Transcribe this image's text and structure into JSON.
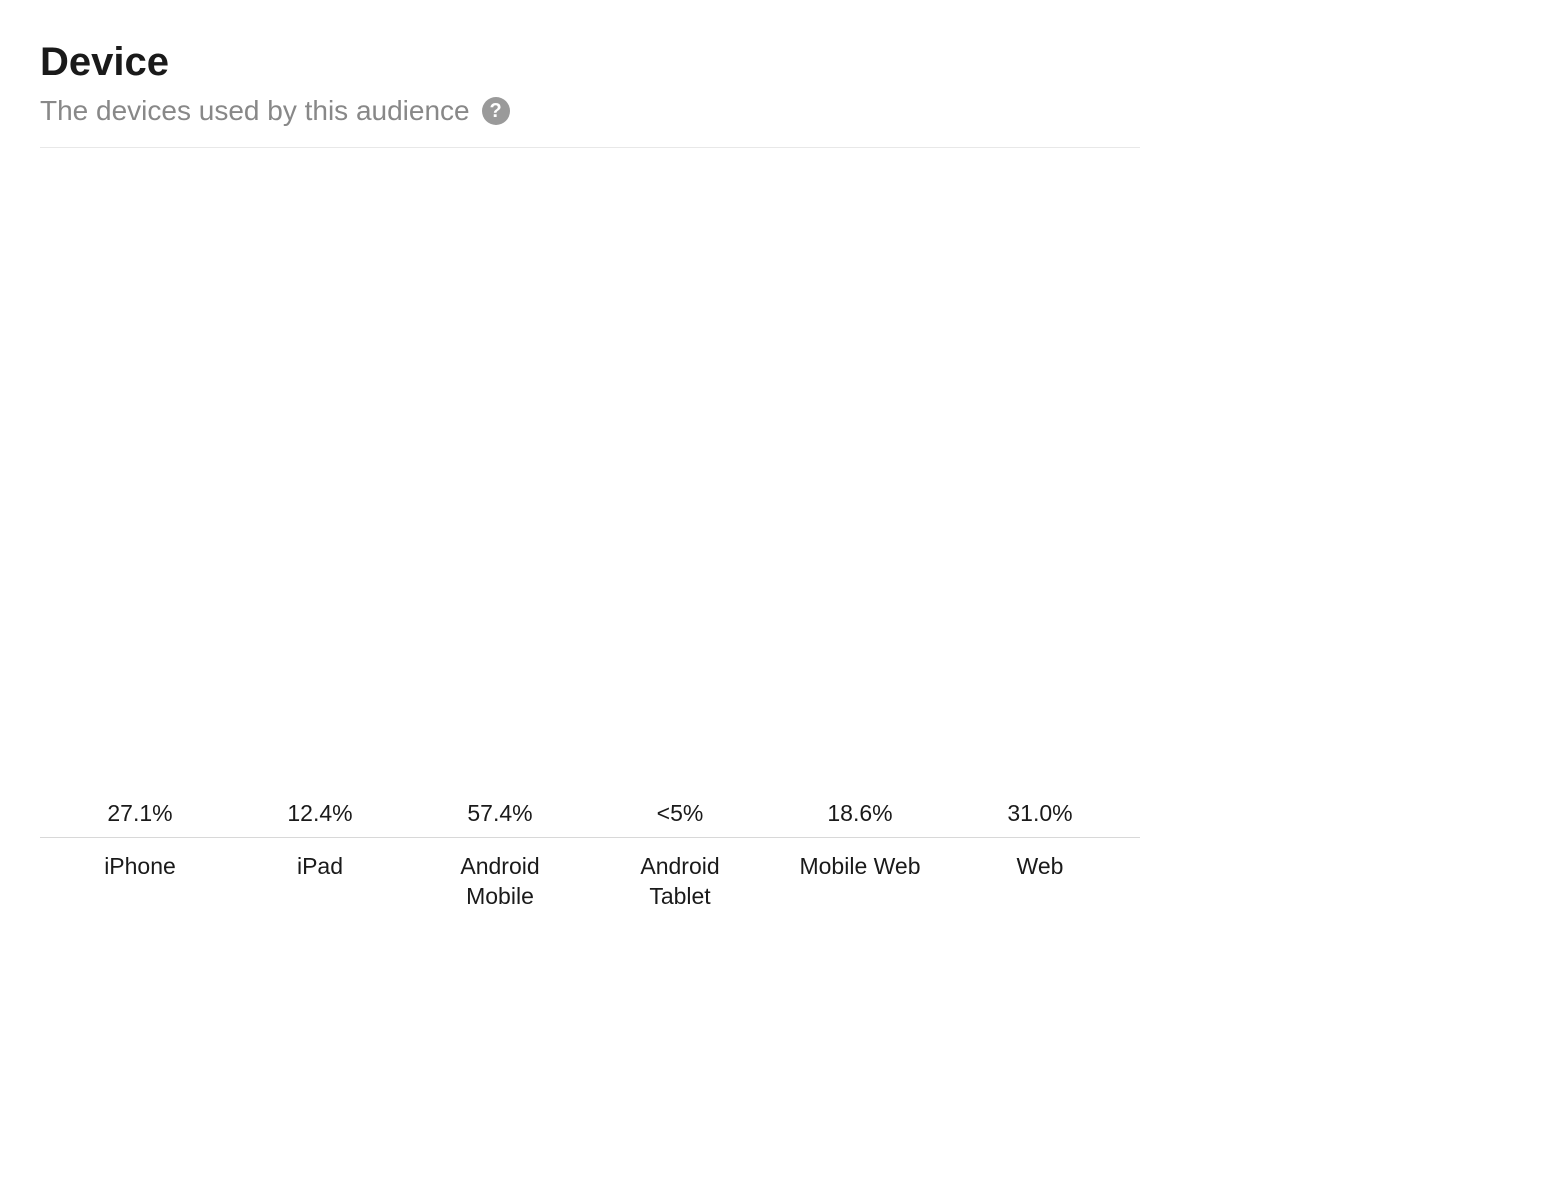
{
  "header": {
    "title": "Device",
    "subtitle": "The devices used by this audience",
    "help_icon_label": "?"
  },
  "chart_data": {
    "type": "bar",
    "title": "Device",
    "subtitle": "The devices used by this audience",
    "xlabel": "",
    "ylabel": "",
    "ylim": [
      0,
      60
    ],
    "bar_color": "#2a5699",
    "categories": [
      "iPhone",
      "iPad",
      "Android Mobile",
      "Android Tablet",
      "Mobile Web",
      "Web"
    ],
    "value_labels": [
      "27.1%",
      "12.4%",
      "57.4%",
      "<5%",
      "18.6%",
      "31.0%"
    ],
    "values": [
      27.1,
      12.4,
      57.4,
      4.5,
      18.6,
      31.0
    ]
  }
}
